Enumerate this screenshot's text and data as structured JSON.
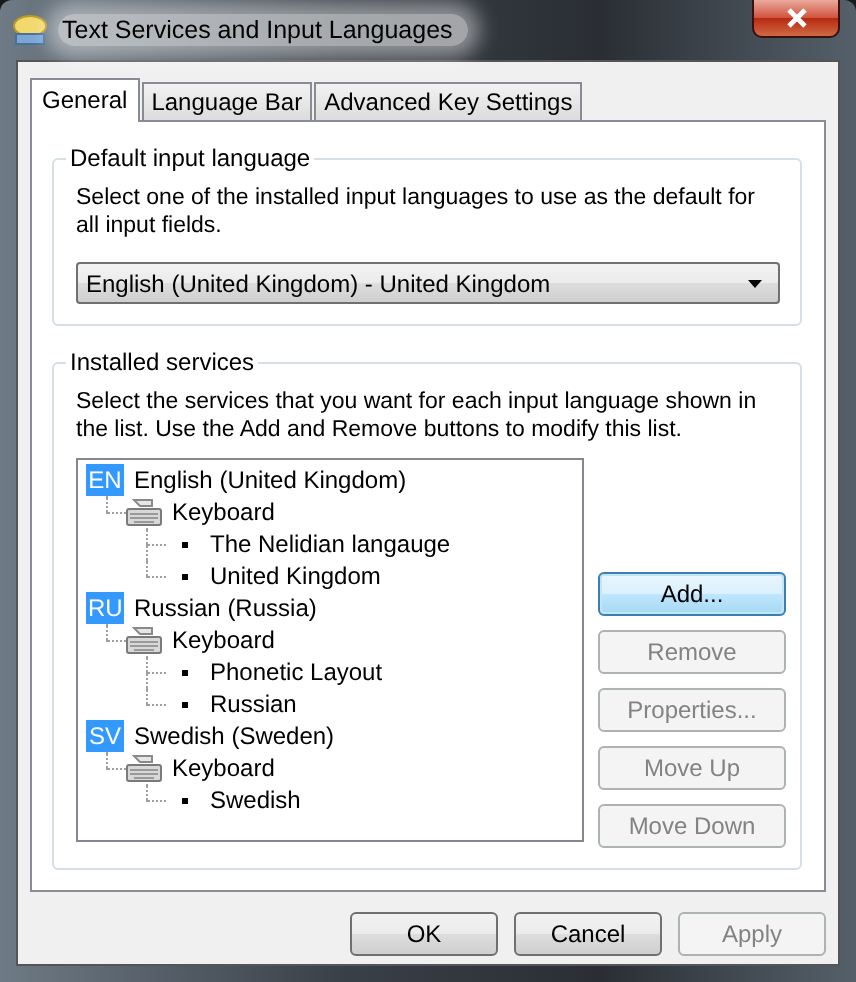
{
  "window": {
    "title": "Text Services and Input Languages"
  },
  "tabs": [
    {
      "label": "General",
      "selected": true
    },
    {
      "label": "Language Bar",
      "selected": false
    },
    {
      "label": "Advanced Key Settings",
      "selected": false
    }
  ],
  "default_input_language": {
    "title": "Default input language",
    "instruction": "Select one of the installed input languages to use as the default for all input fields.",
    "dropdown": {
      "value": "English (United Kingdom) - United Kingdom"
    }
  },
  "installed_services": {
    "title": "Installed services",
    "instruction": "Select the services that you want for each input language shown in the list. Use the Add and Remove buttons to modify this list.",
    "tree": [
      {
        "kind": "language",
        "code": "EN",
        "label": "English (United Kingdom)",
        "children": [
          {
            "kind": "keyboard",
            "label": "Keyboard",
            "children": [
              {
                "kind": "layout",
                "label": "The Nelidian langauge"
              },
              {
                "kind": "layout",
                "label": "United Kingdom"
              }
            ]
          }
        ]
      },
      {
        "kind": "language",
        "code": "RU",
        "label": "Russian (Russia)",
        "children": [
          {
            "kind": "keyboard",
            "label": "Keyboard",
            "children": [
              {
                "kind": "layout",
                "label": "Phonetic Layout"
              },
              {
                "kind": "layout",
                "label": "Russian"
              }
            ]
          }
        ]
      },
      {
        "kind": "language",
        "code": "SV",
        "label": "Swedish (Sweden)",
        "children": [
          {
            "kind": "keyboard",
            "label": "Keyboard",
            "children": [
              {
                "kind": "layout",
                "label": "Swedish"
              }
            ]
          }
        ]
      }
    ],
    "buttons": [
      {
        "label": "Add...",
        "disabled": false,
        "focused": true
      },
      {
        "label": "Remove",
        "disabled": true,
        "focused": false
      },
      {
        "label": "Properties...",
        "disabled": true,
        "focused": false
      },
      {
        "label": "Move Up",
        "disabled": true,
        "focused": false
      },
      {
        "label": "Move Down",
        "disabled": true,
        "focused": false
      }
    ]
  },
  "buttons": [
    {
      "label": "OK",
      "disabled": false,
      "focused": false
    },
    {
      "label": "Cancel",
      "disabled": false,
      "focused": false
    },
    {
      "label": "Apply",
      "disabled": true,
      "focused": false
    }
  ]
}
